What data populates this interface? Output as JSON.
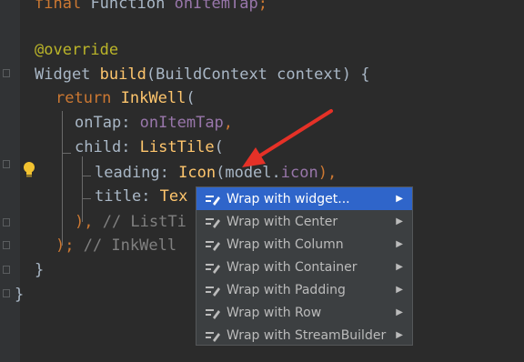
{
  "editor": {
    "lines": {
      "l0": {
        "kw": "final",
        "cls": "Function",
        "name": "onItemTap",
        "semi": ";"
      },
      "l2": {
        "ann": "@override"
      },
      "l3": {
        "type": "Widget",
        "fn": "build",
        "params": "(BuildContext context) {"
      },
      "l4": {
        "kw": "return",
        "cls": "InkWell",
        "paren": "("
      },
      "l5": {
        "prop": "onTap",
        "colon": ": ",
        "val": "onItemTap",
        "comma": ","
      },
      "l6": {
        "prop": "child",
        "colon": ": ",
        "cls": "ListTile",
        "paren": "("
      },
      "l7": {
        "prop": "leading",
        "colon": ": ",
        "cls": "Icon",
        "open": "(",
        "obj": "model",
        "dot": ".",
        "field": "icon",
        "close": "),"
      },
      "l8": {
        "prop": "title",
        "colon": ": ",
        "cls": "Tex"
      },
      "l9": {
        "close": "), ",
        "cmt": "// ListTi"
      },
      "l10": {
        "close": "); ",
        "cmt": "// InkWell"
      },
      "l11": {
        "text": "}"
      },
      "l12": {
        "text": "}"
      }
    }
  },
  "context_menu": {
    "items": [
      {
        "label": "Wrap with widget...",
        "selected": true
      },
      {
        "label": "Wrap with Center"
      },
      {
        "label": "Wrap with Column"
      },
      {
        "label": "Wrap with Container"
      },
      {
        "label": "Wrap with Padding"
      },
      {
        "label": "Wrap with Row"
      },
      {
        "label": "Wrap with StreamBuilder"
      }
    ],
    "item_icon": "edit-pencil-icon",
    "submenu_icon": "chevron-right-icon"
  },
  "colors": {
    "background": "#2b2b2b",
    "keyword": "#cc7832",
    "function": "#ffc66d",
    "annotation": "#bbb529",
    "field": "#9876aa",
    "comment": "#808080",
    "menu_background": "#3c3f41",
    "menu_selected": "#2f65ca",
    "arrow": "#e53127"
  }
}
